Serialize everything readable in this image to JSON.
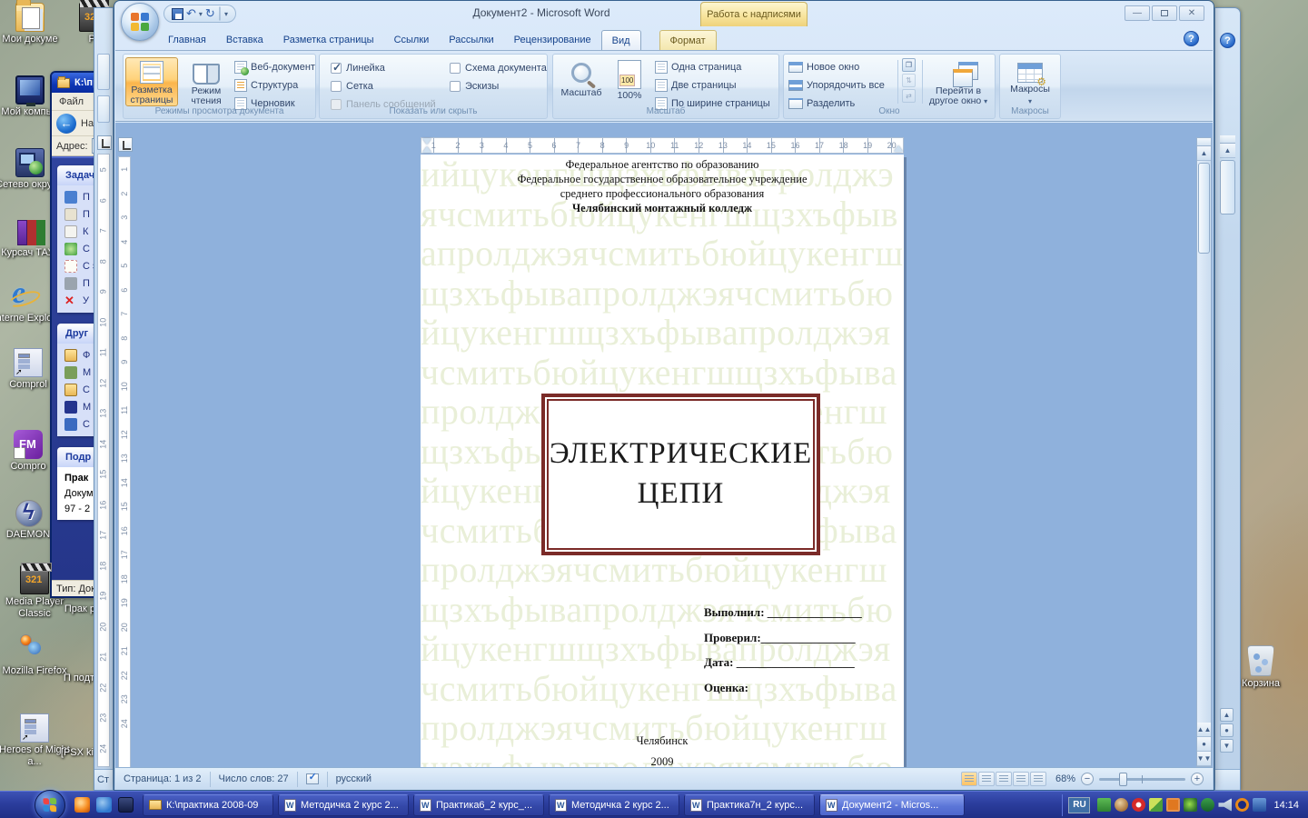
{
  "colors": {
    "taskbar_blue": "#2b3d9d",
    "ribbon_selection_orange": "#fbb54c",
    "doc_area_blue": "#8fb1dc",
    "watermark_green": "#e9efd8",
    "title_box_maroon": "#7b2b28",
    "xp_title_blue": "#0d36b4"
  },
  "desktop": {
    "icons_col1": [
      {
        "label": "Мои докуме"
      },
      {
        "label": "Мой компью"
      },
      {
        "label": "Сетево окруже"
      },
      {
        "label": "Курсач ТАУ.r"
      },
      {
        "label": "Interne Explo"
      },
      {
        "label": "Comprol"
      },
      {
        "label": "Compro"
      },
      {
        "label": "DAEMON"
      },
      {
        "label": "Media Player Classic"
      },
      {
        "label": "Mozilla Firefox"
      },
      {
        "label": "Heroes of Might a..."
      }
    ],
    "icons_col2": [
      {
        "label": "Pr"
      },
      {
        "label": "Прак ра"
      },
      {
        "label": "П подт"
      },
      {
        "label": "[PSX king"
      }
    ],
    "recycle_bin_label": "Корзина"
  },
  "explorer": {
    "title": "К:\\пра",
    "menu_file": "Файл",
    "back_label": "Наз",
    "address_label": "Адрес:",
    "tasks_title": "Задач",
    "task_items": [
      "П",
      "П",
      "К",
      "С",
      "С э",
      "П",
      "У"
    ],
    "other_title": "Друг",
    "other_items": [
      "Ф",
      "М",
      "С",
      "М",
      "С"
    ],
    "details_title": "Подр",
    "details_line1": "Прак",
    "details_line2": "Докум",
    "details_line3": "97 - 2",
    "status": "Тип: Доку"
  },
  "word": {
    "title": "Документ2 - Microsoft Word",
    "contextual_group": "Работа с надписями",
    "tabs": [
      "Главная",
      "Вставка",
      "Разметка страницы",
      "Ссылки",
      "Рассылки",
      "Рецензирование",
      "Вид"
    ],
    "contextual_tab": "Формат",
    "ribbon": {
      "view_modes": {
        "title": "Режимы просмотра документа",
        "print_layout_1": "Разметка",
        "print_layout_2": "страницы",
        "reading_1": "Режим",
        "reading_2": "чтения",
        "web": "Веб-документ",
        "outline": "Структура",
        "draft": "Черновик"
      },
      "show_hide": {
        "title": "Показать или скрыть",
        "ruler": "Линейка",
        "grid": "Сетка",
        "message_bar": "Панель сообщений",
        "doc_map": "Схема документа",
        "thumbs": "Эскизы"
      },
      "zoom": {
        "title": "Масштаб",
        "zoom": "Масштаб",
        "full": "100%",
        "one_page": "Одна страница",
        "two_pages": "Две страницы",
        "page_width": "По ширине страницы"
      },
      "window": {
        "title": "Окно",
        "new_window": "Новое окно",
        "arrange_all": "Упорядочить все",
        "split": "Разделить",
        "switch_1": "Перейти в",
        "switch_2": "другое окно"
      },
      "macros": {
        "title": "Макросы",
        "button": "Макросы"
      }
    },
    "h_ruler": [
      1,
      2,
      3,
      4,
      5,
      6,
      7,
      8,
      9,
      10,
      11,
      12,
      13,
      14,
      15,
      16,
      17,
      18,
      19,
      20
    ],
    "v_ruler": [
      1,
      2,
      3,
      4,
      5,
      6,
      7,
      8,
      9,
      10,
      11,
      12,
      13,
      14,
      15,
      16,
      17,
      18,
      19,
      20,
      21,
      22,
      23,
      24
    ],
    "v_ruler_back": [
      5,
      6,
      7,
      8,
      9,
      10,
      11,
      12,
      13,
      14,
      15,
      16,
      17,
      18,
      19,
      20,
      21,
      22,
      23,
      24
    ],
    "document": {
      "line1": "Федеральное агентство по образованию",
      "line2": "Федеральное государственное образовательное учреждение",
      "line3": "среднего профессионального образования",
      "line4": "Челябинский монтажный колледж",
      "title1": "ЭЛЕКТРИЧЕСКИЕ",
      "title2": "ЦЕПИ",
      "field1": "Выполнил: ________________",
      "field2": "Проверил:________________",
      "field3": "Дата: ____________________",
      "field4": "Оценка:",
      "city": "Челябинск",
      "year": "2009",
      "watermark_lead": "и",
      "watermark_base": "йцукенгшщзхъфывапролджэячсмитьбю",
      "watermark_repeat": 15
    },
    "statusbar": {
      "fragment": "Ст",
      "page": "Страница: 1 из 2",
      "words": "Число слов: 27",
      "lang": "русский",
      "zoom": "68%"
    }
  },
  "taskbar": {
    "buttons": [
      {
        "label": "К:\\практика 2008-09"
      },
      {
        "label": "Методичка 2 курс 2..."
      },
      {
        "label": "Практика6_2 курс_..."
      },
      {
        "label": "Методичка 2 курс 2..."
      },
      {
        "label": "Практика7н_2 курс..."
      },
      {
        "label": "Документ2 - Micros..."
      }
    ],
    "lang": "RU",
    "clock": "14:14"
  }
}
